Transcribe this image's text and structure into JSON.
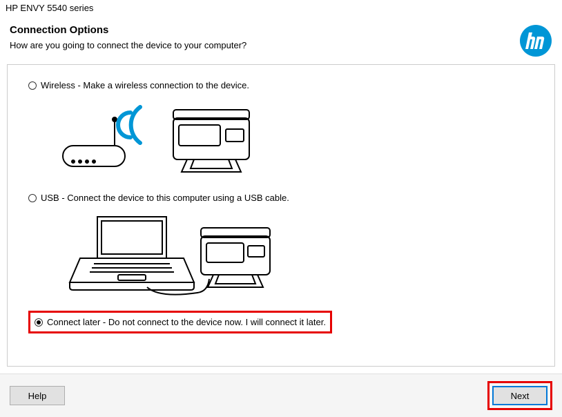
{
  "window_title": "HP ENVY 5540 series",
  "header": {
    "title": "Connection Options",
    "subtitle": "How are you going to connect the device to your computer?"
  },
  "options": {
    "wireless": {
      "label": "Wireless - Make a wireless connection to the device.",
      "selected": false
    },
    "usb": {
      "label": "USB - Connect the device to this computer using a USB cable.",
      "selected": false
    },
    "later": {
      "label": "Connect later - Do not connect to the device now. I will connect it later.",
      "selected": true
    }
  },
  "footer": {
    "help_label": "Help",
    "next_label": "Next"
  },
  "brand": {
    "logo_color": "#0096d6"
  }
}
